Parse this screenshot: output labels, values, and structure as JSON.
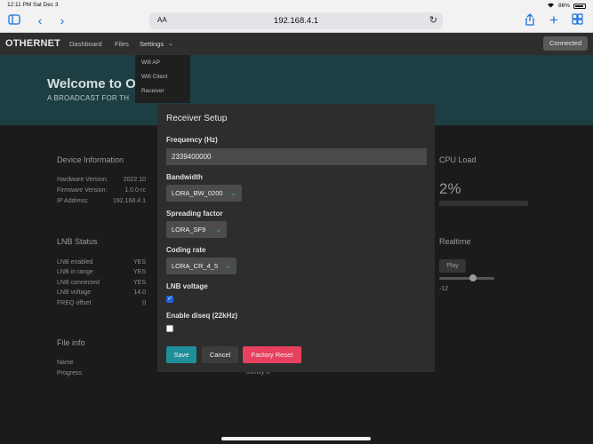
{
  "status_bar": {
    "time": "12:11 PM",
    "date": "Sat Dec 3",
    "battery": "86%"
  },
  "browser": {
    "url": "192.168.4.1",
    "reader_label": "AA",
    "icons": [
      "sidebar-icon",
      "back-icon",
      "forward-icon",
      "reload-icon",
      "share-icon",
      "new-tab-icon",
      "tabs-icon"
    ]
  },
  "navbar": {
    "brand": "OTHERNET",
    "links": [
      "Dashboard",
      "Files",
      "Settings"
    ],
    "status": "Connected"
  },
  "settings_menu": [
    "Wifi AP",
    "Wifi Client",
    "Receiver"
  ],
  "hero": {
    "title": "Welcome to O",
    "subtitle": "A BROADCAST FOR TH"
  },
  "device_info": {
    "title": "Device Information",
    "rows": [
      {
        "label": "Hardware Version:",
        "value": "2022.10"
      },
      {
        "label": "Firmware Version:",
        "value": "1.0.0-rc"
      },
      {
        "label": "IP Address:",
        "value": "192.168.4.1"
      }
    ]
  },
  "lnb_status": {
    "title": "LNB Status",
    "rows": [
      {
        "label": "LNB enabled",
        "value": "YES"
      },
      {
        "label": "LNB in range",
        "value": "YES"
      },
      {
        "label": "LNB connected",
        "value": "YES"
      },
      {
        "label": "LNB voltage",
        "value": "14.0"
      },
      {
        "label": "FREQ offset",
        "value": "0"
      }
    ]
  },
  "file_info": {
    "title": "File info",
    "rows": [
      {
        "label": "Name",
        "value": ""
      },
      {
        "label": "Progress",
        "value": "Infinity%"
      }
    ]
  },
  "cpu": {
    "title": "CPU Load",
    "value": "2%",
    "fraction": 0.02
  },
  "realtime": {
    "title": "Realtime",
    "play_label": "Play",
    "slider_value": "-12"
  },
  "modal": {
    "title": "Receiver Setup",
    "frequency": {
      "label": "Frequency (Hz)",
      "value": "2339400000"
    },
    "bandwidth": {
      "label": "Bandwidth",
      "value": "LORA_BW_0200"
    },
    "spreading_factor": {
      "label": "Spreading factor",
      "value": "LORA_SF9"
    },
    "coding_rate": {
      "label": "Coding rate",
      "value": "LORA_CR_4_5"
    },
    "lnb_voltage": {
      "label": "LNB voltage",
      "checked": true
    },
    "diseqc": {
      "label": "Enable diseq (22kHz)",
      "checked": false
    },
    "buttons": {
      "save": "Save",
      "cancel": "Cancel",
      "factory_reset": "Factory Reset"
    }
  },
  "colors": {
    "accent": "#1f8f9a",
    "danger": "#e8405f",
    "hero": "#1d3f43",
    "checkbox": "#1e63d9"
  }
}
